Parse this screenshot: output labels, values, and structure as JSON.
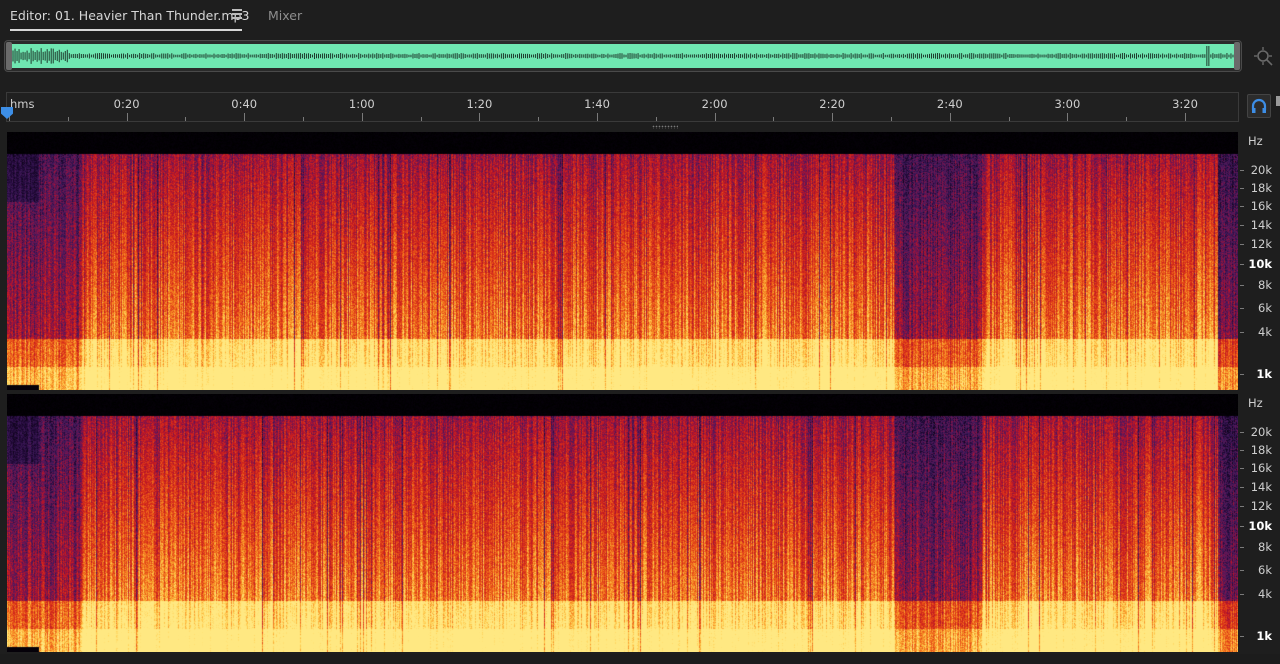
{
  "tabs": {
    "editor_label": "Editor: 01. Heavier Than Thunder.mp3",
    "mixer_label": "Mixer"
  },
  "colors": {
    "overview_waveform": "#6fe7b1",
    "playhead": "#3d8ee6",
    "spectrum_hot": "#ffe070",
    "spectrum_mid": "#d0281a",
    "spectrum_cool": "#401a5c"
  },
  "icons": {
    "tab_menu": "hamburger-icon",
    "zoom_navigator": "zoom-navigator-icon",
    "loop_toggle": "headphone-icon"
  },
  "ruler": {
    "unit_label": "hms",
    "labels": [
      "0:20",
      "0:40",
      "1:00",
      "1:20",
      "1:40",
      "2:00",
      "2:20",
      "2:40",
      "3:00",
      "3:20"
    ],
    "label_seconds": [
      20,
      40,
      60,
      80,
      100,
      120,
      140,
      160,
      180,
      200
    ],
    "duration_seconds": 209
  },
  "frequency_axis": {
    "unit": "Hz",
    "max_hz": 22050,
    "labels": [
      {
        "text": "20k",
        "hz": 20000,
        "strong": false
      },
      {
        "text": "18k",
        "hz": 18000,
        "strong": false
      },
      {
        "text": "16k",
        "hz": 16000,
        "strong": false
      },
      {
        "text": "14k",
        "hz": 14000,
        "strong": false
      },
      {
        "text": "12k",
        "hz": 12000,
        "strong": false
      },
      {
        "text": "10k",
        "hz": 10000,
        "strong": true
      },
      {
        "text": "8k",
        "hz": 8000,
        "strong": false
      },
      {
        "text": "6k",
        "hz": 6000,
        "strong": false
      },
      {
        "text": "4k",
        "hz": 4000,
        "strong": false
      },
      {
        "text": "1k",
        "hz": 1000,
        "strong": true
      }
    ]
  },
  "spectrogram": {
    "channels": 2,
    "lowpass_cutoff_hz": 20000,
    "quiet_sections_seconds": [
      [
        0,
        12
      ],
      [
        154,
        166
      ],
      [
        164,
        166
      ],
      [
        203,
        204
      ]
    ]
  }
}
